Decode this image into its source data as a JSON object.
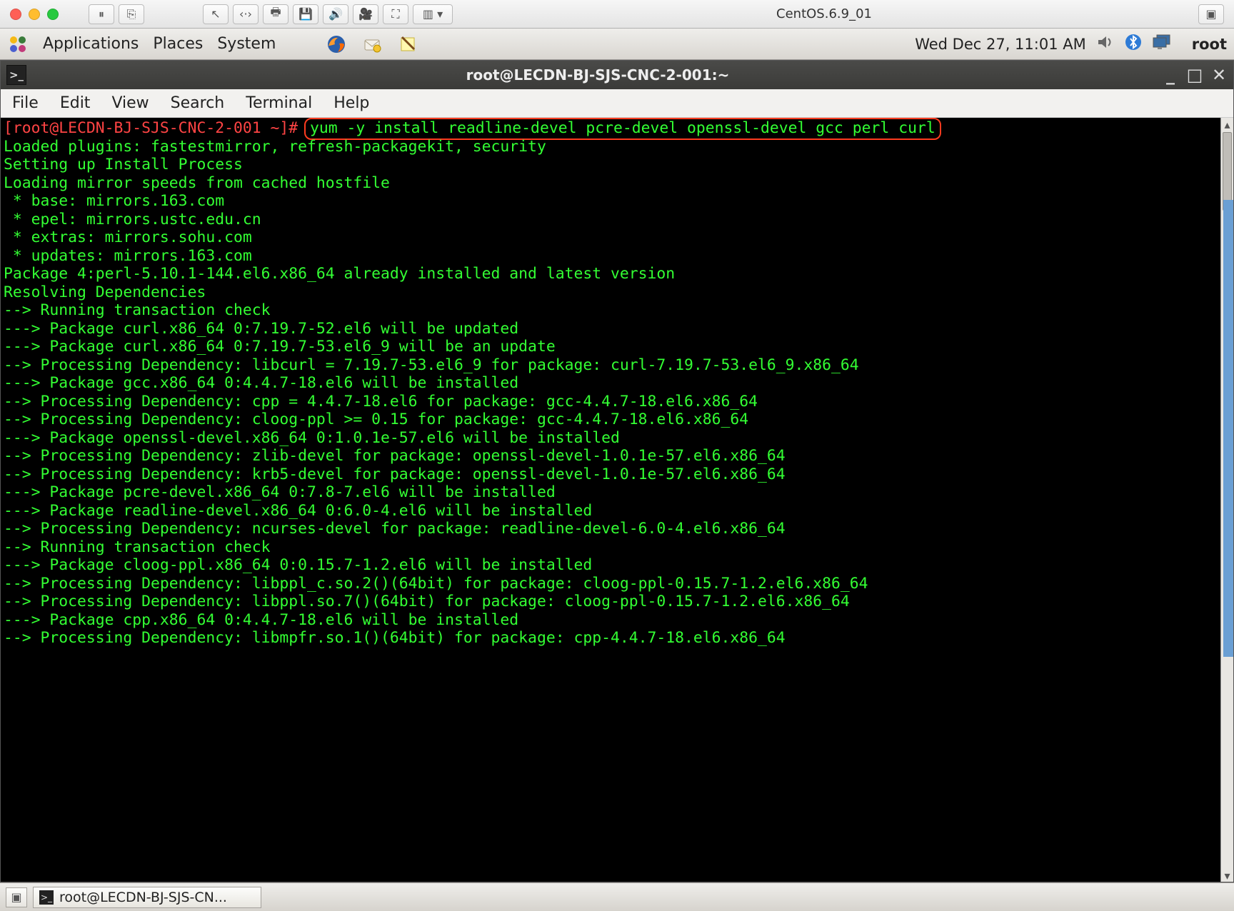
{
  "mac": {
    "vm_title": "CentOS.6.9_01",
    "tool_glyphs": [
      "⏸",
      "⎘",
      "│",
      "↖",
      "‹·›",
      "🖶",
      "💾",
      "🔊",
      "🎥",
      "⛶",
      "▥ ▾"
    ]
  },
  "gnome": {
    "menus": [
      "Applications",
      "Places",
      "System"
    ],
    "clock": "Wed Dec 27, 11:01 AM",
    "user": "root"
  },
  "terminal": {
    "title": "root@LECDN-BJ-SJS-CNC-2-001:~",
    "menus": [
      "File",
      "Edit",
      "View",
      "Search",
      "Terminal",
      "Help"
    ],
    "prompt": "[root@LECDN-BJ-SJS-CNC-2-001 ~]# ",
    "command": "yum -y install readline-devel pcre-devel openssl-devel gcc perl curl",
    "lines": [
      "Loaded plugins: fastestmirror, refresh-packagekit, security",
      "Setting up Install Process",
      "Loading mirror speeds from cached hostfile",
      " * base: mirrors.163.com",
      " * epel: mirrors.ustc.edu.cn",
      " * extras: mirrors.sohu.com",
      " * updates: mirrors.163.com",
      "Package 4:perl-5.10.1-144.el6.x86_64 already installed and latest version",
      "Resolving Dependencies",
      "--> Running transaction check",
      "---> Package curl.x86_64 0:7.19.7-52.el6 will be updated",
      "---> Package curl.x86_64 0:7.19.7-53.el6_9 will be an update",
      "--> Processing Dependency: libcurl = 7.19.7-53.el6_9 for package: curl-7.19.7-53.el6_9.x86_64",
      "---> Package gcc.x86_64 0:4.4.7-18.el6 will be installed",
      "--> Processing Dependency: cpp = 4.4.7-18.el6 for package: gcc-4.4.7-18.el6.x86_64",
      "--> Processing Dependency: cloog-ppl >= 0.15 for package: gcc-4.4.7-18.el6.x86_64",
      "---> Package openssl-devel.x86_64 0:1.0.1e-57.el6 will be installed",
      "--> Processing Dependency: zlib-devel for package: openssl-devel-1.0.1e-57.el6.x86_64",
      "--> Processing Dependency: krb5-devel for package: openssl-devel-1.0.1e-57.el6.x86_64",
      "---> Package pcre-devel.x86_64 0:7.8-7.el6 will be installed",
      "---> Package readline-devel.x86_64 0:6.0-4.el6 will be installed",
      "--> Processing Dependency: ncurses-devel for package: readline-devel-6.0-4.el6.x86_64",
      "--> Running transaction check",
      "---> Package cloog-ppl.x86_64 0:0.15.7-1.2.el6 will be installed",
      "--> Processing Dependency: libppl_c.so.2()(64bit) for package: cloog-ppl-0.15.7-1.2.el6.x86_64",
      "--> Processing Dependency: libppl.so.7()(64bit) for package: cloog-ppl-0.15.7-1.2.el6.x86_64",
      "---> Package cpp.x86_64 0:4.4.7-18.el6 will be installed",
      "--> Processing Dependency: libmpfr.so.1()(64bit) for package: cpp-4.4.7-18.el6.x86_64"
    ]
  },
  "taskbar": {
    "task_label": "root@LECDN-BJ-SJS-CN..."
  }
}
